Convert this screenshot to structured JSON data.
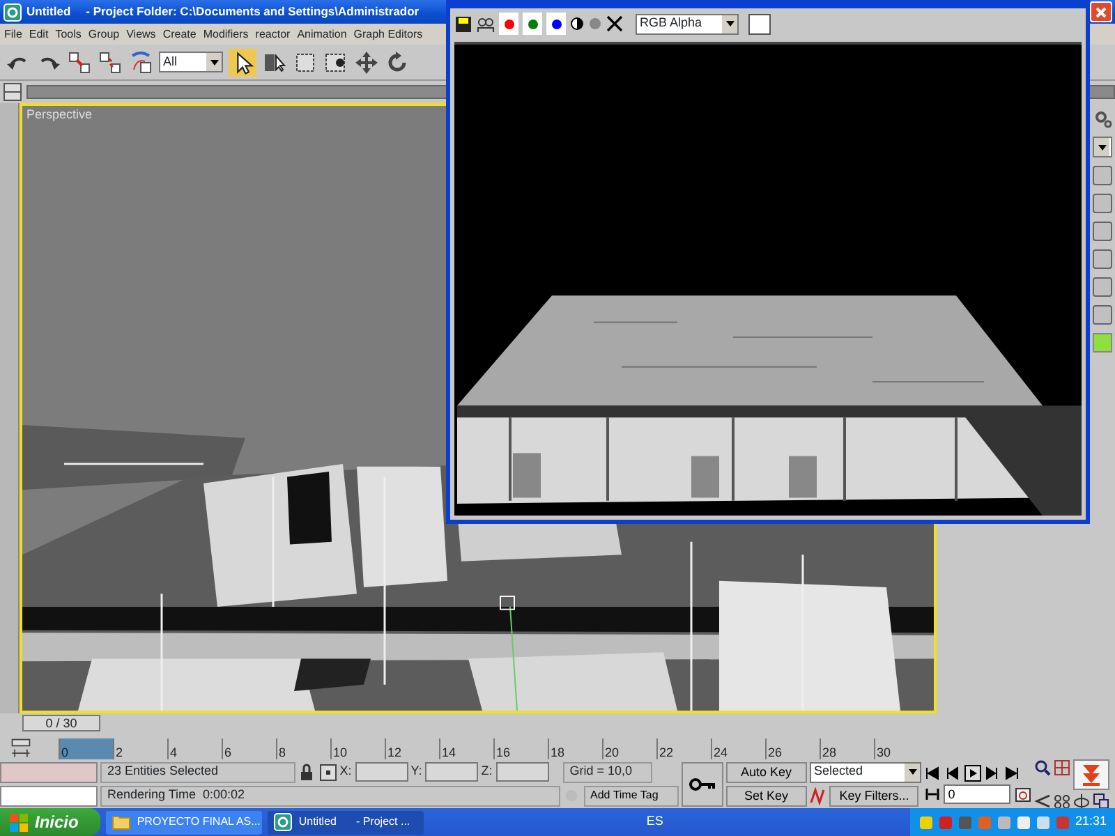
{
  "window": {
    "title": "Untitled",
    "project_folder": "- Project Folder: C:\\Documents and Settings\\Administrador"
  },
  "menu": [
    "File",
    "Edit",
    "Tools",
    "Group",
    "Views",
    "Create",
    "Modifiers",
    "reactor",
    "Animation",
    "Graph Editors"
  ],
  "toolbar": {
    "selection_filter": "All"
  },
  "viewport": {
    "label": "Perspective"
  },
  "render_window": {
    "channel": "RGB Alpha",
    "channels": [
      {
        "color": "#ff0000",
        "on": true
      },
      {
        "color": "#008000",
        "on": true
      },
      {
        "color": "#0000ff",
        "on": true
      }
    ]
  },
  "time_slider": {
    "label": "0 / 30"
  },
  "ruler": {
    "ticks": [
      {
        "label": "0",
        "selected": true
      },
      {
        "label": "2",
        "selected": false
      },
      {
        "label": "4",
        "selected": false
      },
      {
        "label": "6",
        "selected": false
      },
      {
        "label": "8",
        "selected": false
      },
      {
        "label": "10",
        "selected": false
      },
      {
        "label": "12",
        "selected": false
      },
      {
        "label": "14",
        "selected": false
      },
      {
        "label": "16",
        "selected": false
      },
      {
        "label": "18",
        "selected": false
      },
      {
        "label": "20",
        "selected": false
      },
      {
        "label": "22",
        "selected": false
      },
      {
        "label": "24",
        "selected": false
      },
      {
        "label": "26",
        "selected": false
      },
      {
        "label": "28",
        "selected": false
      },
      {
        "label": "30",
        "selected": false
      }
    ]
  },
  "status": {
    "selection": "23 Entities Selected",
    "prompt": "Rendering Time  0:00:02",
    "x_label": "X:",
    "y_label": "Y:",
    "z_label": "Z:",
    "grid": "Grid = 10,0",
    "time_tag": "Add Time Tag"
  },
  "animation": {
    "auto_key": "Auto Key",
    "set_key": "Set Key",
    "key_mode": "Selected",
    "key_filters": "Key Filters...",
    "frame": "0"
  },
  "taskbar": {
    "start": "Inicio",
    "tasks": [
      {
        "title": "PROYECTO FINAL AS...",
        "selected": false
      },
      {
        "title": "Untitled",
        "suffix": "- Project ...",
        "selected": true
      }
    ],
    "language": "ES",
    "clock": "21:31"
  }
}
